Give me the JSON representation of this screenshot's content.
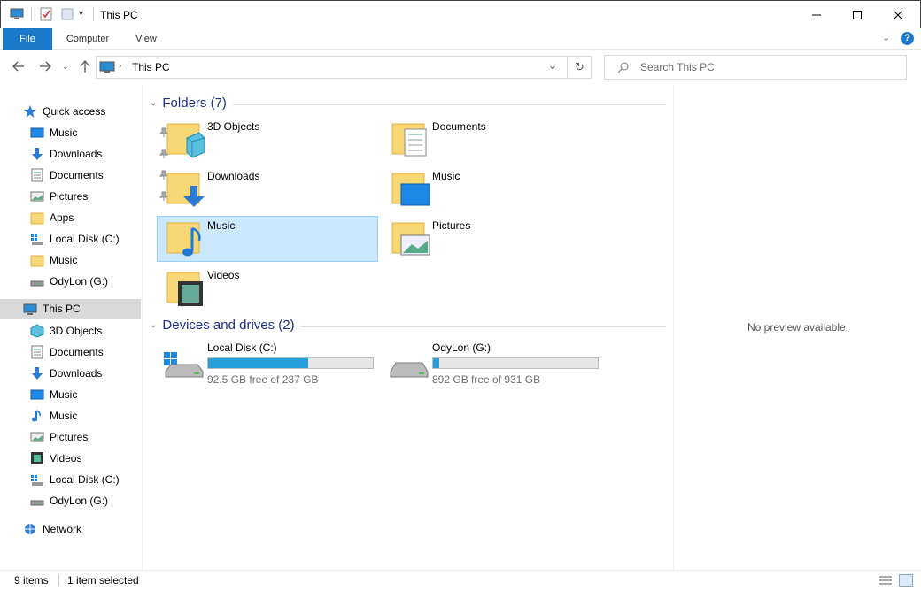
{
  "window": {
    "title": "This PC",
    "minimize_icon": "minimize-icon",
    "maximize_icon": "maximize-icon",
    "close_icon": "close-icon"
  },
  "ribbon": {
    "tabs": [
      {
        "label": "File"
      },
      {
        "label": "Computer"
      },
      {
        "label": "View"
      }
    ]
  },
  "address": {
    "path": "This PC",
    "search_placeholder": "Search This PC"
  },
  "nav": {
    "quick_access": "Quick access",
    "quick_items": [
      {
        "label": "Music",
        "icon": "music-desktop-icon",
        "pinned": true
      },
      {
        "label": "Downloads",
        "icon": "download-arrow-icon",
        "pinned": true
      },
      {
        "label": "Documents",
        "icon": "document-icon",
        "pinned": true
      },
      {
        "label": "Pictures",
        "icon": "pictures-icon",
        "pinned": true
      },
      {
        "label": "Apps",
        "icon": "folder-icon",
        "pinned": false
      },
      {
        "label": "Local Disk (C:)",
        "icon": "windows-drive-icon",
        "pinned": false
      },
      {
        "label": "Music",
        "icon": "folder-icon",
        "pinned": false
      },
      {
        "label": "OdyLon (G:)",
        "icon": "drive-icon",
        "pinned": false
      }
    ],
    "this_pc": "This PC",
    "pc_items": [
      {
        "label": "3D Objects",
        "icon": "3d-objects-icon"
      },
      {
        "label": "Documents",
        "icon": "document-icon"
      },
      {
        "label": "Downloads",
        "icon": "download-arrow-icon"
      },
      {
        "label": "Music",
        "icon": "music-desktop-icon"
      },
      {
        "label": "Music",
        "icon": "music-note-icon"
      },
      {
        "label": "Pictures",
        "icon": "pictures-icon"
      },
      {
        "label": "Videos",
        "icon": "videos-icon"
      },
      {
        "label": "Local Disk (C:)",
        "icon": "windows-drive-icon"
      },
      {
        "label": "OdyLon (G:)",
        "icon": "drive-icon"
      }
    ],
    "network": "Network"
  },
  "content": {
    "folders_header": "Folders (7)",
    "folders": [
      {
        "label": "3D Objects"
      },
      {
        "label": "Documents"
      },
      {
        "label": "Downloads"
      },
      {
        "label": "Music"
      },
      {
        "label": "Music"
      },
      {
        "label": "Pictures"
      },
      {
        "label": "Videos"
      }
    ],
    "drives_header": "Devices and drives (2)",
    "drives": [
      {
        "label": "Local Disk (C:)",
        "free": "92.5 GB free of 237 GB",
        "used_fraction": 0.61
      },
      {
        "label": "OdyLon (G:)",
        "free": "892 GB free of 931 GB",
        "used_fraction": 0.04
      }
    ]
  },
  "preview": {
    "text": "No preview available."
  },
  "status": {
    "items_count": "9 items",
    "selected": "1 item selected"
  },
  "colors": {
    "accent": "#1979ca",
    "selection": "#cce8ff",
    "drive_bar": "#26a0da",
    "header_text": "#1e3287"
  }
}
